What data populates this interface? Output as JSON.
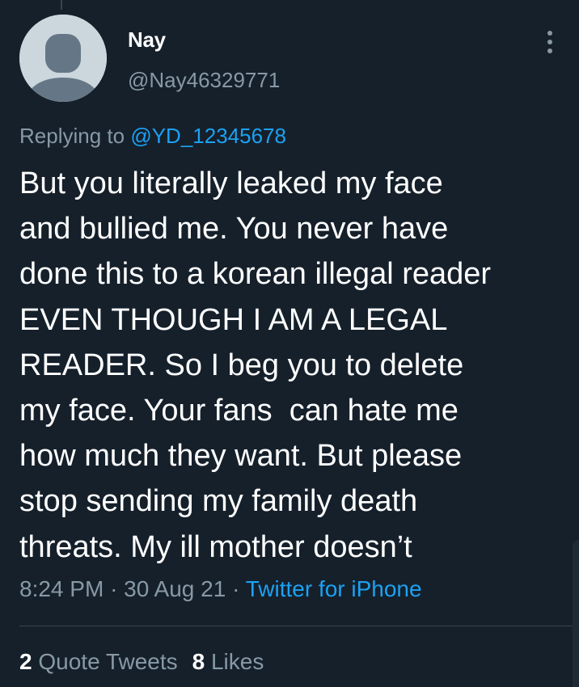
{
  "tweet": {
    "author": {
      "display_name": "Nay",
      "handle": "@Nay46329771",
      "avatar_icon": "default-avatar-icon"
    },
    "replying_to_prefix": "Replying to",
    "replying_to_handle": "@YD_12345678",
    "text_lines": [
      "But you literally leaked my face",
      "and bullied me. You never have",
      "done this to a korean illegal reader",
      "EVEN THOUGH I AM A LEGAL",
      "READER. So I beg you to delete",
      "my face. Your fans  can hate me",
      "how much they want. But please",
      "stop sending my family death",
      "threats. My ill mother doesn’t"
    ],
    "time": "8:24 PM",
    "separator": "·",
    "date": "30 Aug 21",
    "source": "Twitter for iPhone",
    "stats": {
      "quote_tweets_count": "2",
      "quote_tweets_label": "Quote Tweets",
      "likes_count": "8",
      "likes_label": "Likes"
    },
    "more_icon": "more-vertical-icon"
  },
  "colors": {
    "background": "#15202b",
    "text": "#ffffff",
    "secondary_text": "#8899a6",
    "accent": "#1da1f2",
    "divider": "#38444d"
  }
}
